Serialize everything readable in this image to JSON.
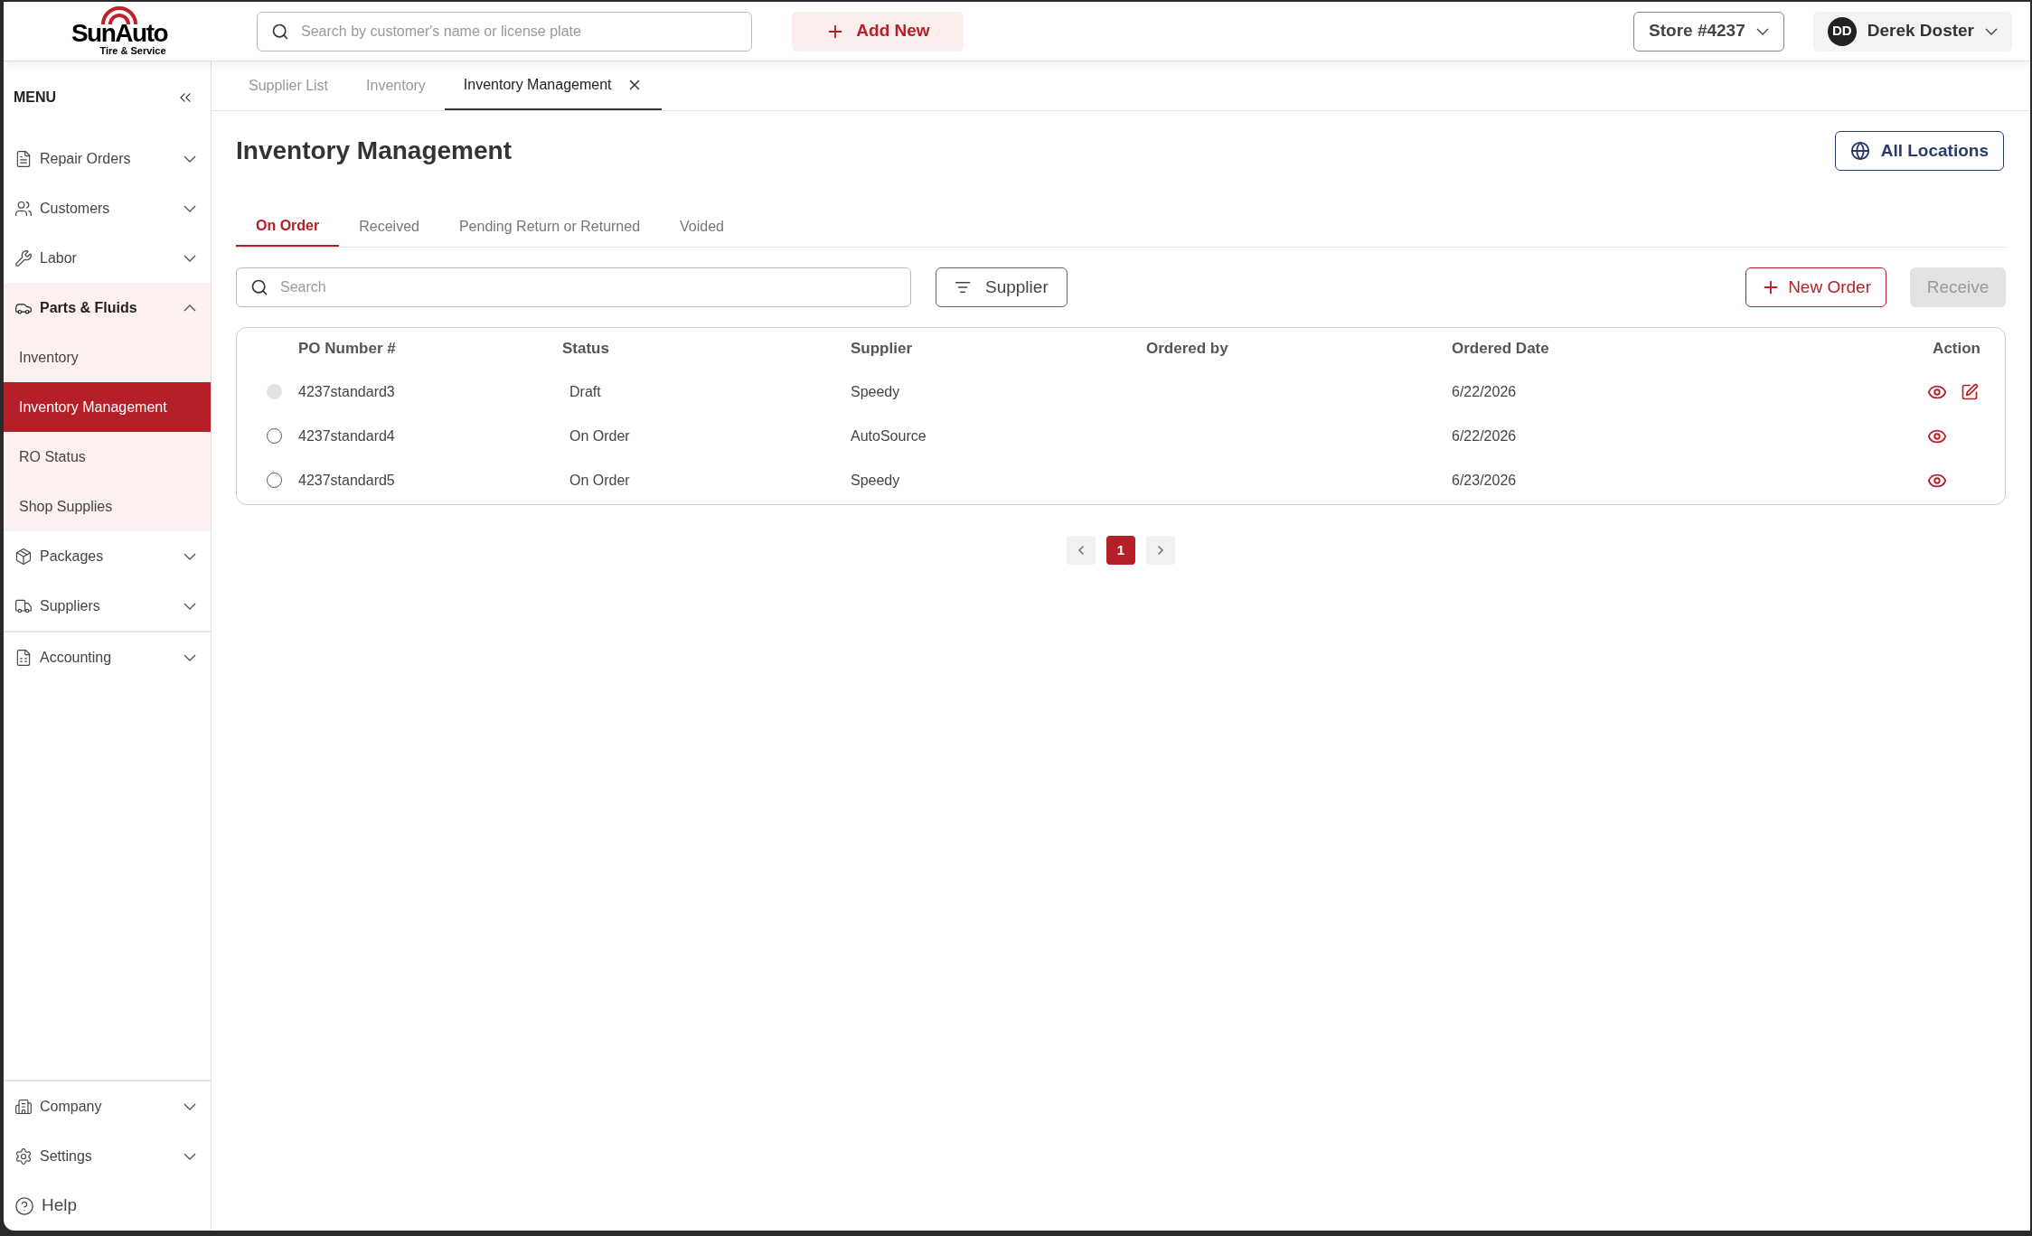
{
  "logo": {
    "name": "SunAuto",
    "tagline": "Tire & Service"
  },
  "header": {
    "search": {
      "placeholder": "Search by customer's name or license plate"
    },
    "add_new": "Add New",
    "store": "Store #4237",
    "user": {
      "initials": "DD",
      "name": "Derek Doster"
    }
  },
  "sidebar": {
    "title": "MENU",
    "sections": [
      [
        {
          "kind": "group",
          "label": "Repair Orders",
          "expanded": false
        },
        {
          "kind": "group",
          "label": "Customers",
          "expanded": false
        },
        {
          "kind": "group",
          "label": "Labor",
          "expanded": false
        },
        {
          "kind": "group",
          "label": "Parts & Fluids",
          "expanded": true,
          "children": [
            {
              "label": "Inventory",
              "selected": false
            },
            {
              "label": "Inventory Management",
              "selected": true
            },
            {
              "label": "RO Status",
              "selected": false
            },
            {
              "label": "Shop Supplies",
              "selected": false
            }
          ]
        },
        {
          "kind": "group",
          "label": "Packages",
          "expanded": false
        },
        {
          "kind": "group",
          "label": "Suppliers",
          "expanded": false
        }
      ],
      [
        {
          "kind": "group",
          "label": "Accounting",
          "expanded": false
        }
      ],
      [
        {
          "kind": "group",
          "label": "Company",
          "expanded": false
        },
        {
          "kind": "group",
          "label": "Settings",
          "expanded": false
        },
        {
          "kind": "link",
          "label": "Help"
        }
      ]
    ]
  },
  "page_tabs": [
    {
      "label": "Supplier List",
      "selected": false,
      "closable": false
    },
    {
      "label": "Inventory",
      "selected": false,
      "closable": false
    },
    {
      "label": "Inventory Management",
      "selected": true,
      "closable": true
    }
  ],
  "title": "Inventory Management",
  "locations_button": "All Locations",
  "status_tabs": [
    {
      "label": "On Order",
      "selected": true
    },
    {
      "label": "Received",
      "selected": false
    },
    {
      "label": "Pending Return or Returned",
      "selected": false
    },
    {
      "label": "Voided",
      "selected": false
    }
  ],
  "search": {
    "placeholder": "Search"
  },
  "supplier_filter": "Supplier",
  "new_order": "New Order",
  "receive": {
    "label": "Receive",
    "disabled": true
  },
  "table": {
    "columns": [
      "PO Number #",
      "Status",
      "Supplier",
      "Ordered by",
      "Ordered Date",
      "Action"
    ],
    "rows": [
      {
        "po": "4237standard3",
        "status": "Draft",
        "supplier": "Speedy",
        "ordered_date": "6/22/2026",
        "disabled": true,
        "selected": false,
        "editable": true
      },
      {
        "po": "4237standard4",
        "status": "On Order",
        "supplier": "AutoSource",
        "ordered_date": "6/22/2026",
        "disabled": false,
        "selected": false,
        "editable": false
      },
      {
        "po": "4237standard5",
        "status": "On Order",
        "supplier": "Speedy",
        "ordered_date": "6/23/2026",
        "disabled": false,
        "selected": false,
        "editable": false
      }
    ]
  },
  "pagination": [
    {
      "label": "1",
      "selected": true
    }
  ]
}
